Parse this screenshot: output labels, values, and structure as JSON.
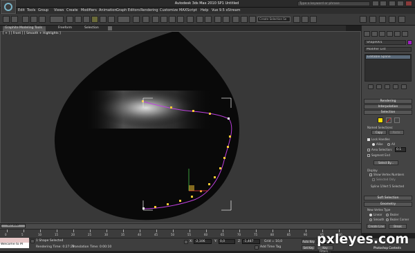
{
  "app": {
    "title": "Autodesk 3ds Max 2010 SP1   Untitled",
    "search_placeholder": "Type a keyword or phrase"
  },
  "menu": [
    "Edit",
    "Tools",
    "Group",
    "Views",
    "Create",
    "Modifiers",
    "Animation",
    "Graph Editors",
    "Rendering",
    "Customize",
    "MAXScript",
    "Help",
    "Vue 9.5 xStream"
  ],
  "toolbar": {
    "selection_set_placeholder": "Create Selection Se"
  },
  "ribbon": {
    "tabs": [
      "Graphite Modeling Tools",
      "Freeform",
      "Selection"
    ]
  },
  "viewport": {
    "label": "[ + ] [ Front ] [ Smooth + Highlights ]"
  },
  "command_panel": {
    "object_name": "Shape001",
    "modifier_list_label": "Modifier List",
    "stack_item": "Editable Spline",
    "rollouts": {
      "rendering": "Rendering",
      "interpolation": "Interpolation",
      "selection": "Selection",
      "soft_selection": "Soft Selection",
      "geometry": "Geometry"
    },
    "named_selections_label": "Named Selections:",
    "copy_button": "Copy",
    "paste_button": "Paste",
    "lock_handles": "Lock Handles",
    "alike": "Alike",
    "all": "All",
    "area_selection": "Area Selection:",
    "area_value": "0.1",
    "segment_end": "Segment End",
    "select_by": "Select By...",
    "display_label": "Display",
    "show_vertex_numbers": "Show Vertex Numbers",
    "selected_only": "Selected Only",
    "spline_status": "Spline 1/Vert 5 Selected",
    "new_vertex_type": "New Vertex Type",
    "linear": "Linear",
    "bezier": "Bezier",
    "smooth": "Smooth",
    "bezier_corner": "Bezier Corner",
    "create_line": "Create Line",
    "break": "Break",
    "accent_color": "#ffe000"
  },
  "timeline": {
    "frame": "0 / 100",
    "ticks": [
      "0",
      "5",
      "10",
      "15",
      "20",
      "25",
      "30",
      "35",
      "40",
      "45",
      "50",
      "55",
      "60",
      "65",
      "70",
      "75",
      "80",
      "85",
      "90",
      "95",
      "100"
    ]
  },
  "status": {
    "maxscript_text": "Welcome to M",
    "selection_text": "1 Shape Selected",
    "render_time": "Rendering Time: 0:27:29",
    "translation_time": "Translation Time: 0:00:10",
    "x_value": "-2,106",
    "y_value": "0,0",
    "z_value": "-1,487",
    "grid": "Grid = 10,0",
    "add_time_tag": "Add Time Tag",
    "auto_key": "Auto Key",
    "set_key": "Set Key",
    "key_mode": "Selected",
    "key_filters": "Key Filters..."
  },
  "watermark": {
    "brand": "pxleyes.com",
    "sub": "Photoshop Contests"
  }
}
